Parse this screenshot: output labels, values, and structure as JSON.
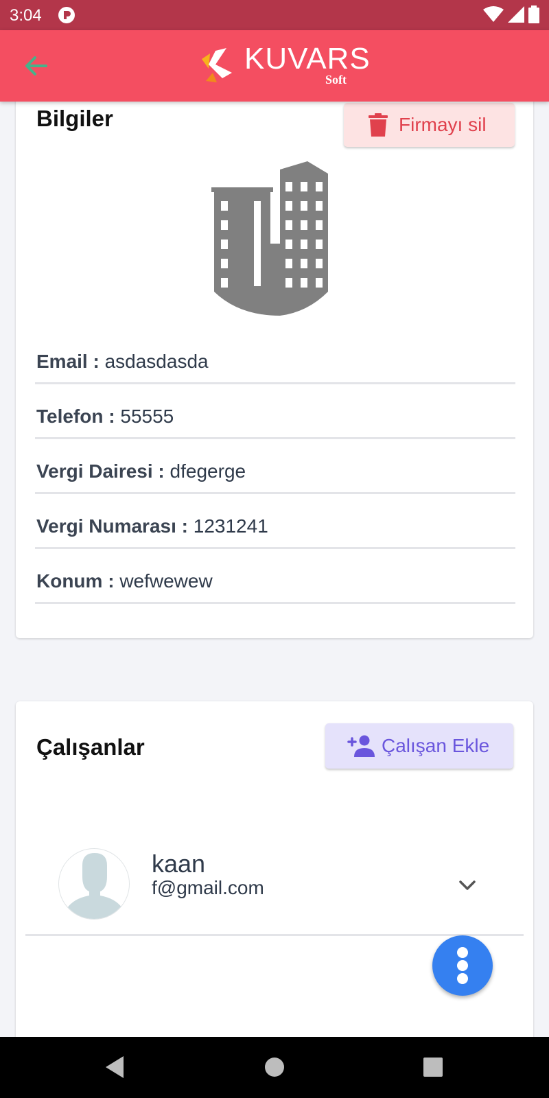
{
  "status_bar": {
    "time": "3:04"
  },
  "app_bar": {
    "logo_text": "KUVARS",
    "logo_sub": "Soft"
  },
  "info": {
    "title": "Bilgiler",
    "delete_label": "Firmayı sil",
    "fields": [
      {
        "label": "Email :",
        "value": "asdasdasda"
      },
      {
        "label": "Telefon :",
        "value": "55555"
      },
      {
        "label": "Vergi Dairesi :",
        "value": "dfegerge"
      },
      {
        "label": "Vergi Numarası :",
        "value": "1231241"
      },
      {
        "label": "Konum :",
        "value": "wefwewew"
      }
    ]
  },
  "employees": {
    "title": "Çalışanlar",
    "add_label": "Çalışan Ekle",
    "items": [
      {
        "name": "kaan",
        "email": "f@gmail.com"
      }
    ]
  },
  "colors": {
    "app_bar": "#f44e61",
    "status_bar": "#b3364a",
    "delete_accent": "#e0414d",
    "add_accent": "#6a56dd",
    "fab": "#3580f0"
  }
}
